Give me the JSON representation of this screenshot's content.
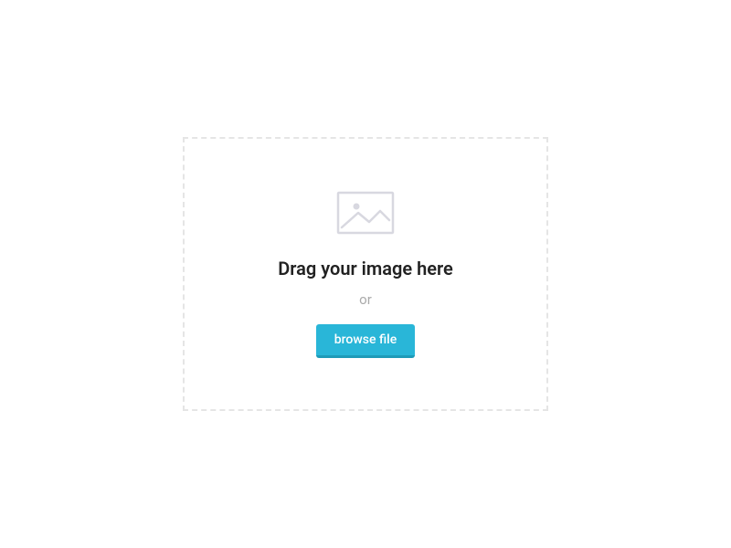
{
  "dropzone": {
    "heading": "Drag your image here",
    "or_label": "or",
    "browse_label": "browse file"
  }
}
